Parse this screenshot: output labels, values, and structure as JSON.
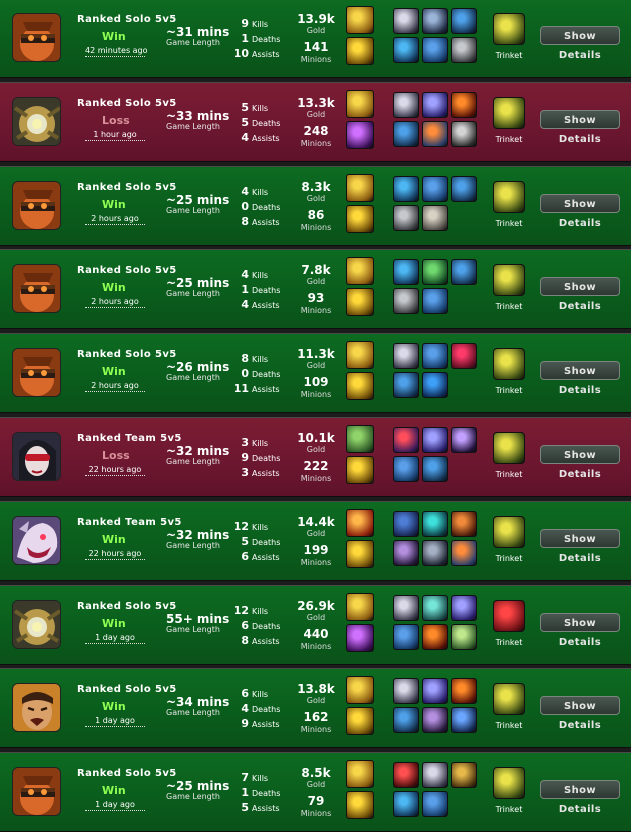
{
  "labels": {
    "kills": "Kills",
    "deaths": "Deaths",
    "assists": "Assists",
    "gold": "Gold",
    "minions": "Minions",
    "game_length": "Game Length",
    "trinket": "Trinket",
    "show_details": "Show Details"
  },
  "colors": {
    "win_bg": "#0a5c1c",
    "loss_bg": "#6c1730",
    "win_text": "#8dff52",
    "loss_text": "#d8909a"
  },
  "matches": [
    {
      "queue": "Ranked Solo 5v5",
      "result": "Win",
      "ago": "42 minutes ago",
      "length": "~31 mins",
      "kills": "9",
      "deaths": "1",
      "assists": "10",
      "gold": "13.9k",
      "minions": "141",
      "champion_icon": "red-mask-champion-icon",
      "spells": [
        "flash-icon",
        "ignite-icon"
      ],
      "items": [
        "armor-icon",
        "blade-icon",
        "boots-icon",
        "wind-icon",
        "blue-tome-icon",
        "chest-icon"
      ]
    },
    {
      "queue": "Ranked Solo 5v5",
      "result": "Loss",
      "ago": "1 hour ago",
      "length": "~33 mins",
      "kills": "5",
      "deaths": "5",
      "assists": "4",
      "gold": "13.3k",
      "minions": "248",
      "champion_icon": "golden-mech-champion-icon",
      "spells": [
        "flash-icon",
        "purple-spell-icon"
      ],
      "items": [
        "armor-icon",
        "lightning-icon",
        "fire-icon",
        "boots-icon",
        "orange-blade-icon",
        "sword-icon"
      ]
    },
    {
      "queue": "Ranked Solo 5v5",
      "result": "Win",
      "ago": "2 hours ago",
      "length": "~25 mins",
      "kills": "4",
      "deaths": "0",
      "assists": "8",
      "gold": "8.3k",
      "minions": "86",
      "champion_icon": "red-mask-champion-icon",
      "spells": [
        "flash-icon",
        "ignite-icon"
      ],
      "items": [
        "wind-icon",
        "blue-tome-icon",
        "boots-icon",
        "chest-icon",
        "shell-icon"
      ]
    },
    {
      "queue": "Ranked Solo 5v5",
      "result": "Win",
      "ago": "2 hours ago",
      "length": "~25 mins",
      "kills": "4",
      "deaths": "1",
      "assists": "4",
      "gold": "7.8k",
      "minions": "93",
      "champion_icon": "red-mask-champion-icon",
      "spells": [
        "flash-icon",
        "ignite-icon"
      ],
      "items": [
        "wind-icon",
        "eye-icon",
        "boots-icon",
        "chest-icon",
        "blue-tome-icon"
      ]
    },
    {
      "queue": "Ranked Solo 5v5",
      "result": "Win",
      "ago": "2 hours ago",
      "length": "~26 mins",
      "kills": "8",
      "deaths": "0",
      "assists": "11",
      "gold": "11.3k",
      "minions": "109",
      "champion_icon": "red-mask-champion-icon",
      "spells": [
        "flash-icon",
        "ignite-icon"
      ],
      "items": [
        "armor-icon",
        "blue-tome-icon",
        "ruby-icon",
        "boots-icon",
        "blue-orb-icon"
      ]
    },
    {
      "queue": "Ranked Team 5v5",
      "result": "Loss",
      "ago": "22 hours ago",
      "length": "~32 mins",
      "kills": "3",
      "deaths": "9",
      "assists": "3",
      "gold": "10.1k",
      "minions": "222",
      "champion_icon": "vampire-champion-icon",
      "spells": [
        "heal-icon",
        "ignite-icon"
      ],
      "items": [
        "red-blade-icon",
        "lightning-icon",
        "purple-sword-icon",
        "blue-tome-icon",
        "boots-icon"
      ]
    },
    {
      "queue": "Ranked Team 5v5",
      "result": "Win",
      "ago": "22 hours ago",
      "length": "~32 mins",
      "kills": "12",
      "deaths": "5",
      "assists": "6",
      "gold": "14.4k",
      "minions": "199",
      "champion_icon": "beast-champion-icon",
      "spells": [
        "fire-spell-icon",
        "ignite-icon"
      ],
      "items": [
        "blue-ring-icon",
        "teal-orb-icon",
        "hammer-icon",
        "chain-icon",
        "scythe-icon",
        "orange-blade-icon"
      ]
    },
    {
      "queue": "Ranked Solo 5v5",
      "result": "Win",
      "ago": "1 day ago",
      "length": "55+ mins",
      "kills": "12",
      "deaths": "6",
      "assists": "8",
      "gold": "26.9k",
      "minions": "440",
      "champion_icon": "golden-mech-champion-icon",
      "spells": [
        "flash-icon",
        "purple-spell-icon"
      ],
      "items": [
        "armor-icon",
        "cyan-gem-icon",
        "lightning-icon",
        "blue-tome-icon",
        "fire-icon",
        "green-bow-icon"
      ]
    },
    {
      "queue": "Ranked Solo 5v5",
      "result": "Win",
      "ago": "1 day ago",
      "length": "~34 mins",
      "kills": "6",
      "deaths": "4",
      "assists": "9",
      "gold": "13.8k",
      "minions": "162",
      "champion_icon": "warrior-champion-icon",
      "spells": [
        "flash-icon",
        "ignite-icon"
      ],
      "items": [
        "armor-icon",
        "lightning-icon",
        "fire-icon",
        "boots-icon",
        "chain-icon",
        "blue-mesh-icon"
      ]
    },
    {
      "queue": "Ranked Solo 5v5",
      "result": "Win",
      "ago": "1 day ago",
      "length": "~25 mins",
      "kills": "7",
      "deaths": "1",
      "assists": "5",
      "gold": "8.5k",
      "minions": "79",
      "champion_icon": "red-mask-champion-icon",
      "spells": [
        "flash-icon",
        "ignite-icon"
      ],
      "items": [
        "red-potion-icon",
        "armor-icon",
        "gold-claw-icon",
        "wind-icon",
        "blue-tome-icon"
      ]
    }
  ],
  "trinkets": [
    "yellow-totem-icon",
    "yellow-totem-icon",
    "yellow-totem-icon",
    "yellow-totem-icon",
    "yellow-totem-icon",
    "yellow-totem-icon",
    "yellow-totem-icon",
    "red-sweeper-icon",
    "yellow-totem-icon",
    "yellow-totem-icon"
  ]
}
